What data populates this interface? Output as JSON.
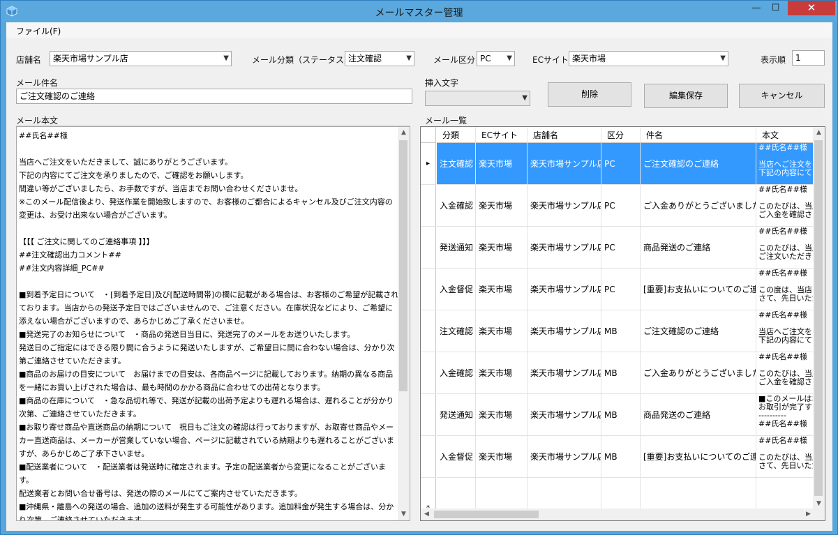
{
  "window": {
    "title": "メールマスター管理"
  },
  "menu": {
    "file": "ファイル(F)"
  },
  "form": {
    "shop_label": "店舗名",
    "shop_value": "楽天市場サンプル店",
    "category_label": "メール分類（ステータス）",
    "category_value": "注文確認",
    "kubun_label": "メール区分",
    "kubun_value": "PC",
    "ec_label": "ECサイト",
    "ec_value": "楽天市場",
    "order_label": "表示順",
    "order_value": "1",
    "subject_label": "メール件名",
    "subject_value": "ご注文確認のご連絡",
    "insert_label": "挿入文字",
    "insert_value": "",
    "body_label": "メール本文",
    "list_label": "メール一覧"
  },
  "buttons": {
    "delete": "削除",
    "save": "編集保存",
    "cancel": "キャンセル"
  },
  "body_text": "##氏名##様\n\n当店へご注文をいただきまして、誠にありがとうございます。\n下記の内容にてご注文を承りましたので、ご確認をお願いします。\n間違い等がございましたら、お手数ですが、当店までお問い合わせくださいませ。\n※このメール配信後より、発送作業を開始致しますので、お客様のご都合によるキャンセル及びご注文内容の変更は、お受け出来ない場合がございます。\n\n【【【 ご注文に関してのご連絡事項 】】】\n##注文確認出力コメント##\n##注文内容詳細_PC##\n\n■到着予定日について　・[到着予定日]及び[配送時間帯]の欄に記載がある場合は、お客様のご希望が記載されております。当店からの発送予定日ではございませんので、ご注意ください。在庫状況などにより、ご希望に添えない場合がございますので、あらかじめご了承くださいませ。\n■発送完了のお知らせについて　・商品の発送日当日に、発送完了のメールをお送りいたします。\n発送日のご指定にはできる限り間に合うように発送いたしますが、ご希望日に間に合わない場合は、分かり次第ご連絡させていただきます。\n■商品のお届けの目安について　お届けまでの目安は、各商品ページに記載しております。納期の異なる商品を一緒にお買い上げされた場合は、最も時間のかかる商品に合わせての出荷となります。\n■商品の在庫について　・急な品切れ等で、発送が記載の出荷予定よりも遅れる場合は、遅れることが分かり次第、ご連絡させていただきます。\n■お取り寄せ商品や直送商品の納期について　祝日もご注文の確認は行っておりますが、お取寄せ商品やメーカー直送商品は、メーカーが営業していない場合、ページに記載されている納期よりも遅れることがございますが、あらかじめご了承下さいませ。\n■配送業者について　・配送業者は発送時に確定されます。予定の配送業者から変更になることがございます。\n配送業者とお問い合せ番号は、発送の際のメールにてご案内させていただきます。\n■沖縄県・離島への発送の場合、追加の送料が発生する可能性があります。追加料金が発生する場合は、分かり次第、ご連絡させていただきます。\n■領収書の発行について",
  "grid": {
    "columns": [
      "分類",
      "ECサイト",
      "店舗名",
      "区分",
      "件名",
      "本文"
    ],
    "rows": [
      {
        "category": "注文確認",
        "ec": "楽天市場",
        "shop": "楽天市場サンプル店",
        "kubun": "PC",
        "subject": "ご注文確認のご連絡",
        "body": "##氏名##様\n\n当店へご注文を\n下記の内容にて"
      },
      {
        "category": "入金確認",
        "ec": "楽天市場",
        "shop": "楽天市場サンプル店",
        "kubun": "PC",
        "subject": "ご入金ありがとうございました",
        "body": "##氏名##様\n\nこのたびは、当店\nご入金を確認さ"
      },
      {
        "category": "発送通知",
        "ec": "楽天市場",
        "shop": "楽天市場サンプル店",
        "kubun": "PC",
        "subject": "商品発送のご連絡",
        "body": "##氏名##様\n\nこのたびは、当店\nご注文いただきま"
      },
      {
        "category": "入金督促",
        "ec": "楽天市場",
        "shop": "楽天市場サンプル店",
        "kubun": "PC",
        "subject": "[重要]お支払いについてのご連絡",
        "body": "##氏名##様\n\nこの度は、当店を\nさて、先日いただ"
      },
      {
        "category": "注文確認",
        "ec": "楽天市場",
        "shop": "楽天市場サンプル店",
        "kubun": "MB",
        "subject": "ご注文確認のご連絡",
        "body": "##氏名##様\n\n当店へご注文を\n下記の内容にて"
      },
      {
        "category": "入金確認",
        "ec": "楽天市場",
        "shop": "楽天市場サンプル店",
        "kubun": "MB",
        "subject": "ご入金ありがとうございました",
        "body": "##氏名##様\n\nこのたびは、当店\nご入金を確認さ"
      },
      {
        "category": "発送通知",
        "ec": "楽天市場",
        "shop": "楽天市場サンプル店",
        "kubun": "MB",
        "subject": "商品発送のご連絡",
        "body": "■このメールはお\nお取引が完了す\n----------\n##氏名##様"
      },
      {
        "category": "入金督促",
        "ec": "楽天市場",
        "shop": "楽天市場サンプル店",
        "kubun": "MB",
        "subject": "[重要]お支払いについてのご連絡",
        "body": "##氏名##様\n\nこのたびは、当店\nさて、先日いただ"
      }
    ],
    "new_row_marker": "*",
    "current_row_marker": "▸",
    "selected_color": "#3399ff"
  },
  "icons": {
    "dropdown": "chevron-down-icon",
    "scroll_up": "scroll-up-icon",
    "scroll_down": "scroll-down-icon"
  }
}
